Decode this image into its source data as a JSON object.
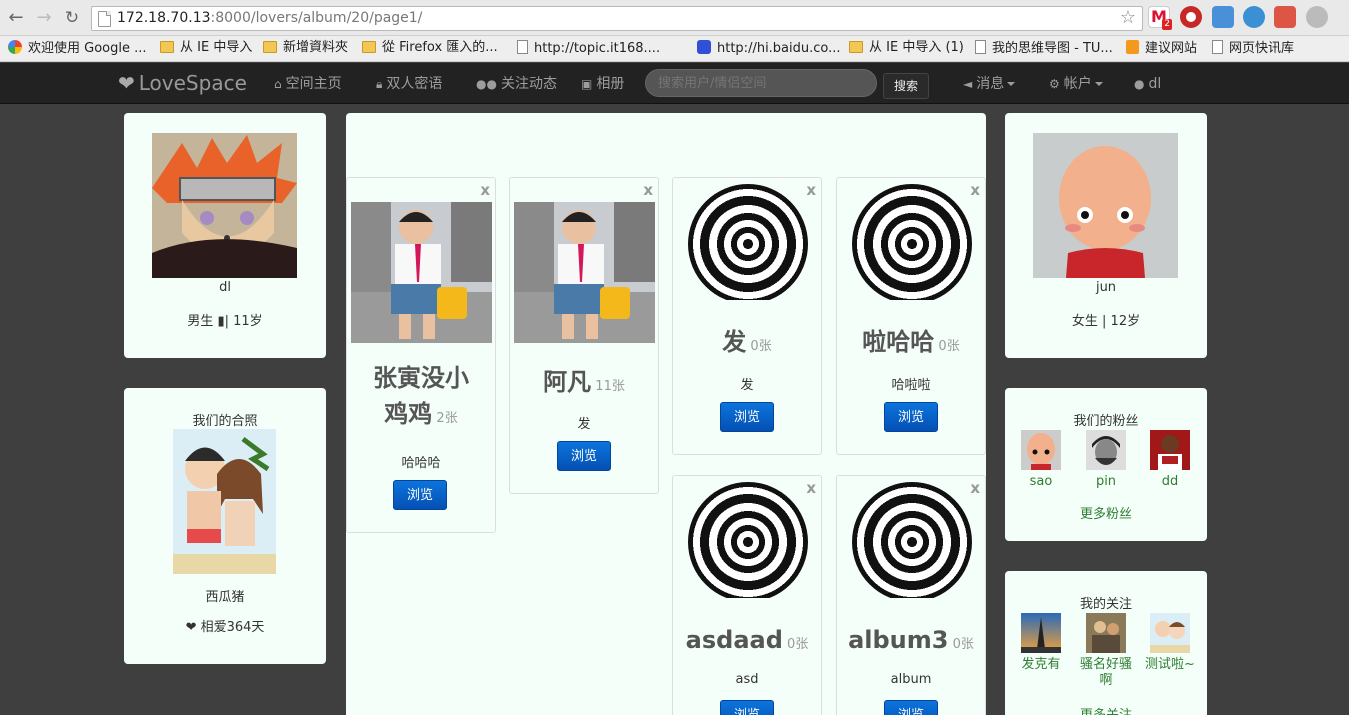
{
  "browser": {
    "url_host": "172.18.70.13",
    "url_rest": ":8000/lovers/album/20/page1/",
    "gmail_badge": "2",
    "bookmarks": [
      {
        "label": "欢迎使用 Google ...",
        "icon": "google-icon"
      },
      {
        "label": "从 IE 中导入",
        "icon": "folder-icon"
      },
      {
        "label": "新增資料夾",
        "icon": "folder-icon"
      },
      {
        "label": "從 Firefox 匯入的...",
        "icon": "folder-icon"
      },
      {
        "label": "http://topic.it168....",
        "icon": "page-icon"
      },
      {
        "label": "http://hi.baidu.co...",
        "icon": "baidu-paw-icon"
      },
      {
        "label": "从 IE 中导入 (1)",
        "icon": "folder-icon"
      },
      {
        "label": "我的思维导图 - TU...",
        "icon": "page-icon"
      },
      {
        "label": "建议网站",
        "icon": "orange-icon"
      },
      {
        "label": "网页快讯库",
        "icon": "page-icon"
      }
    ]
  },
  "navbar": {
    "brand": "LoveSpace",
    "links": [
      {
        "label": "空间主页",
        "icon": "home-icon"
      },
      {
        "label": "双人密语",
        "icon": "lock-icon"
      },
      {
        "label": "关注动态",
        "icon": "users-icon"
      },
      {
        "label": "相册",
        "icon": "picture-icon"
      }
    ],
    "search_placeholder": "搜索用户/情侣空间",
    "search_button": "搜索",
    "messages": "消息",
    "account": "帐户",
    "user": "dl"
  },
  "left": {
    "profile": {
      "name": "dl",
      "info_prefix": "男生",
      "info_suffix": "| 11岁"
    },
    "couple": {
      "heading": "我们的合照",
      "name": "西瓜猪",
      "love_days": "相爱364天"
    }
  },
  "right": {
    "profile": {
      "name": "jun",
      "info": "女生 | 12岁"
    },
    "fans": {
      "heading": "我们的粉丝",
      "items": [
        "sao",
        "pin",
        "dd"
      ],
      "more": "更多粉丝"
    },
    "following": {
      "heading": "我的关注",
      "items": [
        "发克有",
        "骚名好骚啊",
        "测试啦~"
      ],
      "more": "更多关注"
    }
  },
  "albums": [
    {
      "title": "张寅没小鸡鸡",
      "count": "2张",
      "desc": "哈哈哈",
      "browse": "浏览",
      "close": "x"
    },
    {
      "title": "阿凡",
      "count": "11张",
      "desc": "发",
      "browse": "浏览",
      "close": "x"
    },
    {
      "title": "发",
      "count": "0张",
      "desc": "发",
      "browse": "浏览",
      "close": "x"
    },
    {
      "title": "啦哈哈",
      "count": "0张",
      "desc": "哈啦啦",
      "browse": "浏览",
      "close": "x"
    },
    {
      "title": "asdaad",
      "count": "0张",
      "desc": "asd",
      "browse": "浏览",
      "close": "x"
    },
    {
      "title": "album3",
      "count": "0张",
      "desc": "album",
      "browse": "浏览",
      "close": "x"
    }
  ]
}
